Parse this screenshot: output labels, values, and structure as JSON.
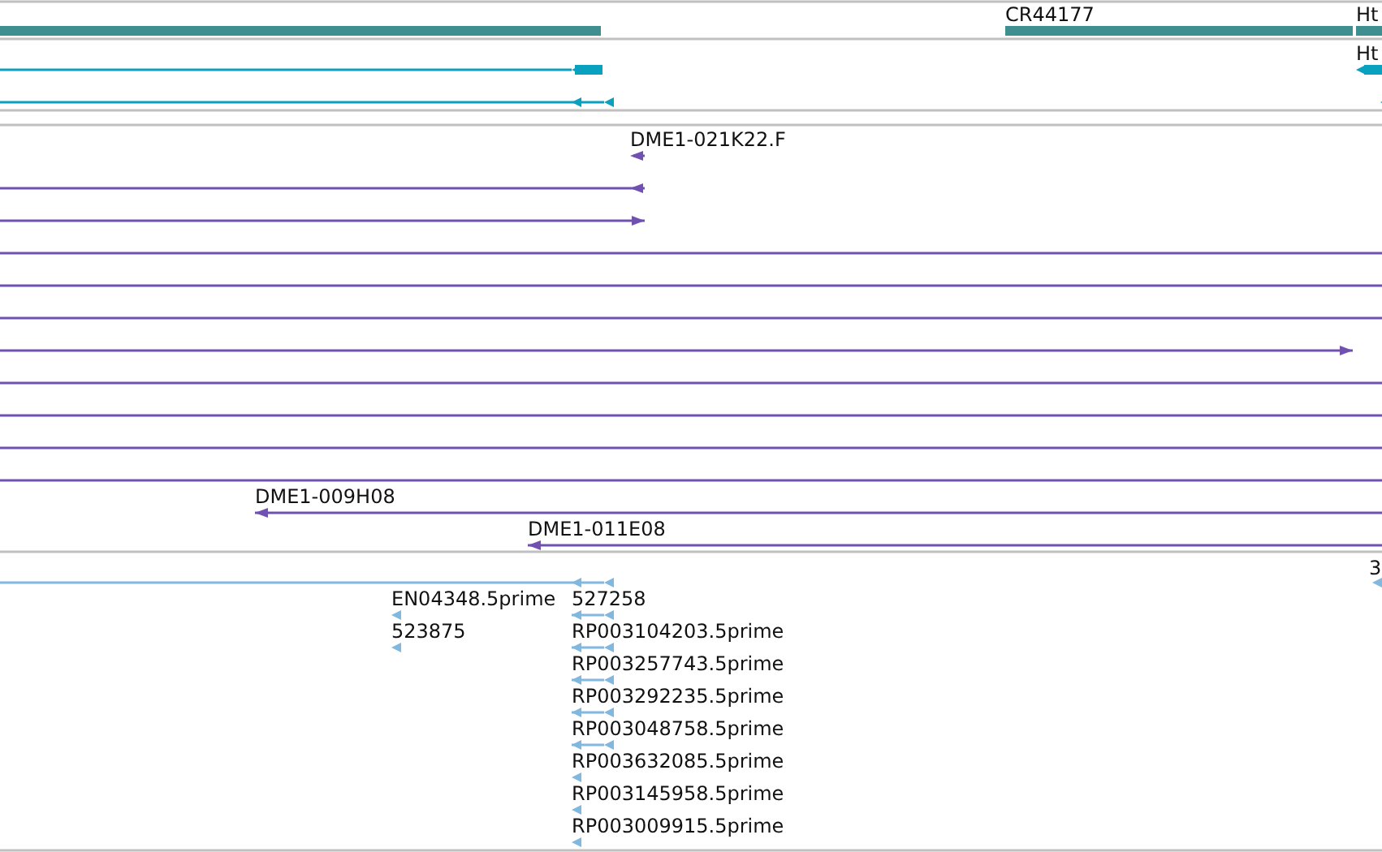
{
  "tracks": [
    {
      "kind": "gene",
      "features": [
        {
          "kind": "plain"
        },
        {
          "kind": "arrow",
          "label": "CR44177",
          "reverse": false
        },
        {
          "kind": "arrow",
          "label": "Ht",
          "reverse": true
        }
      ]
    },
    {
      "kind": "transcript",
      "features": [
        {
          "kind": "arrow",
          "reverse": true
        },
        {
          "kind": "arrow",
          "label": "Ht",
          "reverse": true
        },
        {
          "kind": "arrow",
          "reverse": true
        },
        {
          "kind": "arrow",
          "reverse": true
        }
      ]
    },
    {
      "kind": "empty"
    },
    {
      "kind": "clone",
      "features": [
        {
          "kind": "arrow",
          "label": "DME1-021K22.F",
          "reverse": true
        },
        {
          "kind": "arrow",
          "reverse": true
        },
        {
          "kind": "arrow",
          "reverse": false
        },
        {
          "kind": "plain"
        },
        {
          "kind": "plain"
        },
        {
          "kind": "plain"
        },
        {
          "kind": "arrow",
          "reverse": false
        },
        {
          "kind": "plain"
        },
        {
          "kind": "plain"
        },
        {
          "kind": "plain"
        },
        {
          "kind": "plain"
        },
        {
          "kind": "arrow",
          "label": "DME1-009H08",
          "reverse": true
        },
        {
          "kind": "arrow",
          "label": "DME1-011E08",
          "reverse": true
        }
      ]
    },
    {
      "kind": "est",
      "features": [
        {
          "kind": "arrow",
          "reverse": true
        },
        {
          "kind": "arrow",
          "label": "3",
          "reverse": true
        },
        {
          "kind": "arrow",
          "label": "EN04348.5prime",
          "reverse": true
        },
        {
          "kind": "arrow",
          "label": "527258",
          "reverse": true
        },
        {
          "kind": "arrow",
          "label": "523875",
          "reverse": true
        },
        {
          "kind": "arrow",
          "label": "RP003104203.5prime",
          "reverse": true
        },
        {
          "kind": "arrow",
          "label": "RP003257743.5prime",
          "reverse": true
        },
        {
          "kind": "arrow",
          "label": "RP003292235.5prime",
          "reverse": true
        },
        {
          "kind": "arrow",
          "label": "RP003048758.5prime",
          "reverse": true
        },
        {
          "kind": "arrow",
          "label": "RP003632085.5prime",
          "reverse": true
        },
        {
          "kind": "arrow",
          "label": "RP003145958.5prime",
          "reverse": true
        },
        {
          "kind": "arrow",
          "label": "RP003009915.5prime",
          "reverse": true
        }
      ]
    }
  ]
}
